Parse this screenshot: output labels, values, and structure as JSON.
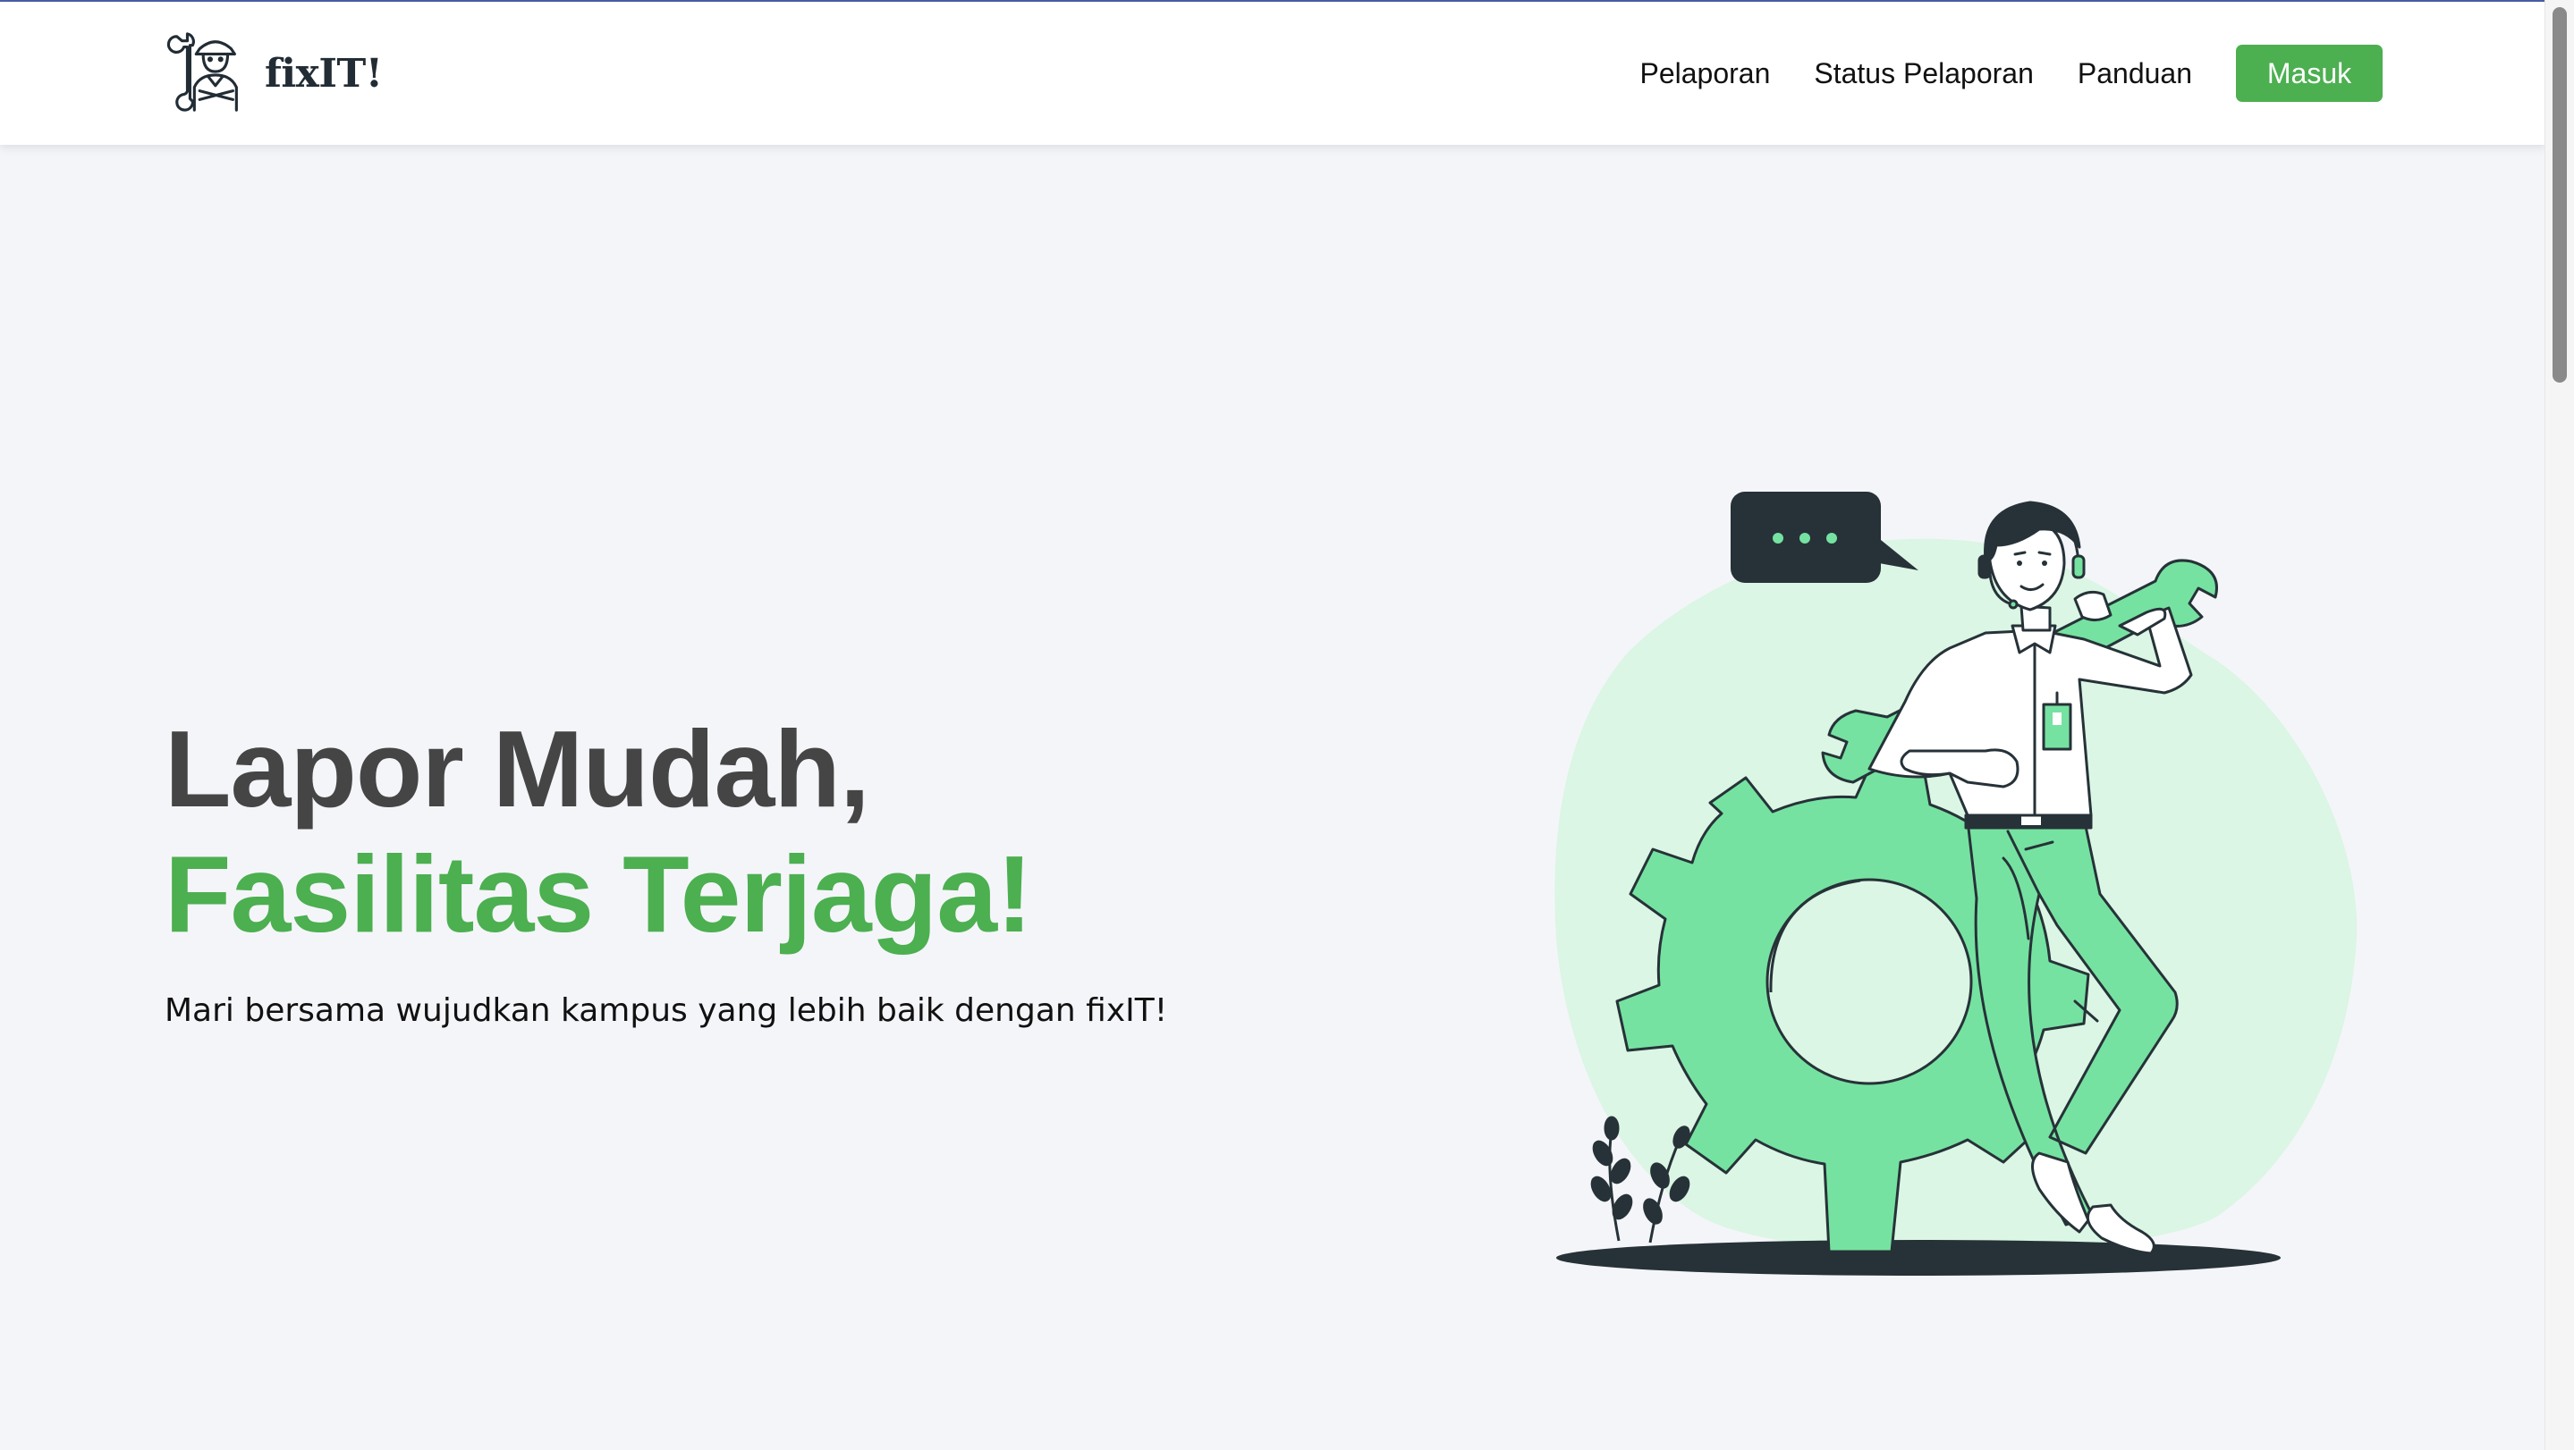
{
  "brand": {
    "name": "fixIT!",
    "logo_icon": "mechanic-icon"
  },
  "nav": {
    "items": [
      {
        "label": "Pelaporan"
      },
      {
        "label": "Status Pelaporan"
      },
      {
        "label": "Panduan"
      }
    ],
    "login_label": "Masuk"
  },
  "hero": {
    "line1": "Lapor Mudah,",
    "line2": "Fasilitas Terjaga!",
    "subtitle": "Mari bersama wujudkan kampus yang lebih baik dengan fixIT!"
  },
  "colors": {
    "accent": "#4caf50",
    "heading": "#454545",
    "background": "#f4f5f9",
    "illustration_green": "#76e2a1",
    "illustration_blob": "#dbf6e4",
    "illustration_dark": "#263238"
  }
}
